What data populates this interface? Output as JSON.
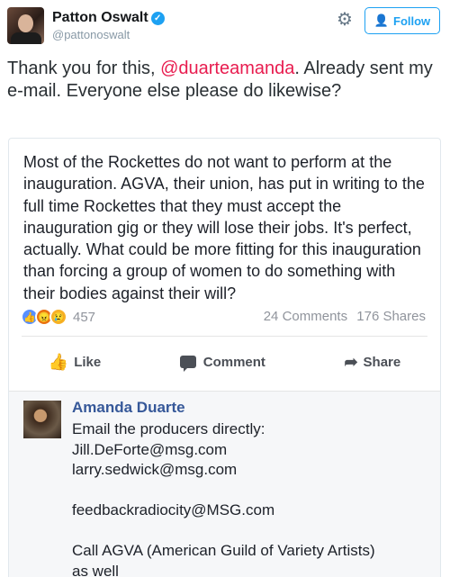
{
  "tweet": {
    "name": "Patton Oswalt",
    "handle": "@pattonoswalt",
    "follow_label": "Follow",
    "text_before": "Thank you for this, ",
    "mention": "@duarteamanda",
    "text_after": ". Already sent my e-mail. Everyone else please do likewise?"
  },
  "fb_post": {
    "text": "Most of the Rockettes do not want to perform at the inauguration. AGVA, their union, has put in writing to the full time Rockettes that they must accept the inauguration gig or they will lose their jobs. It's perfect, actually. What could be more fitting for this inauguration than forcing a group of women to do something with their bodies against their will?",
    "reaction_count": "457",
    "comments": "24 Comments",
    "shares": "176 Shares",
    "actions": {
      "like": "Like",
      "comment": "Comment",
      "share": "Share"
    }
  },
  "fb_comment": {
    "name": "Amanda Duarte",
    "lines": [
      "Email the producers directly:",
      "Jill.DeForte@msg.com",
      "larry.sedwick@msg.com",
      "",
      "feedbackradiocity@MSG.com",
      "",
      "Call AGVA (American Guild of Variety Artists)",
      "as well"
    ]
  },
  "colors": {
    "mention": "#e81c4f",
    "twitter_blue": "#1da1f2",
    "fb_name": "#365899"
  }
}
